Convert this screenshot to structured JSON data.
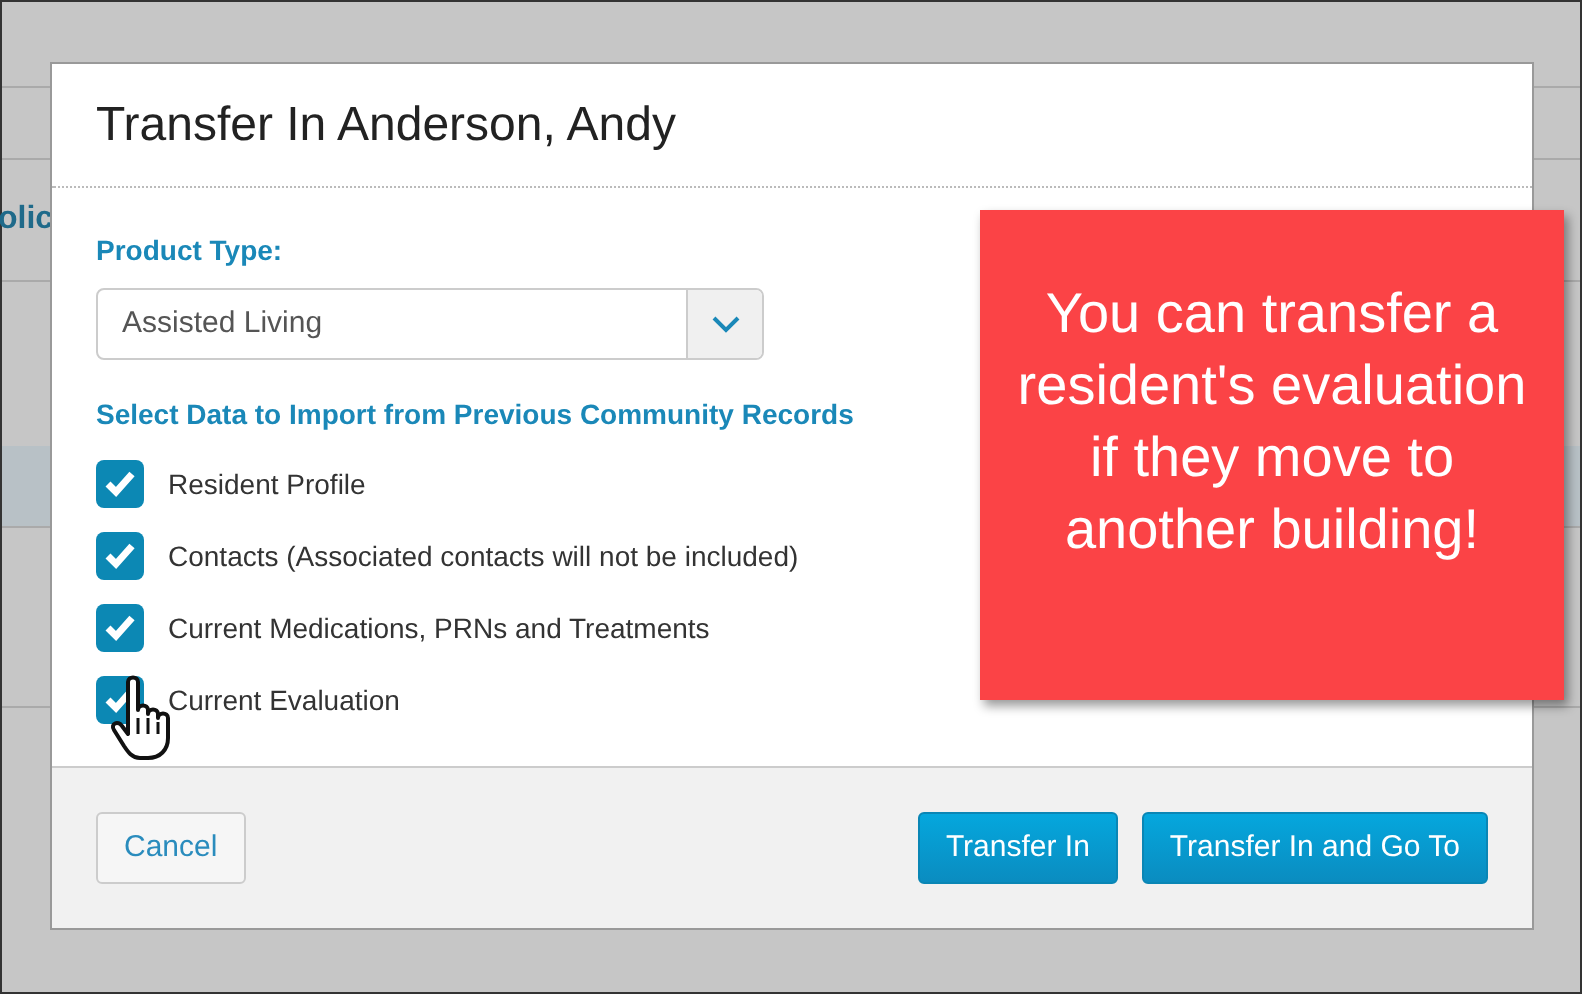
{
  "background": {
    "text_fragment": "olic"
  },
  "dialog": {
    "title": "Transfer In Anderson, Andy",
    "product_type": {
      "label": "Product Type:",
      "value": "Assisted Living"
    },
    "import_heading": "Select Data to Import from Previous Community Records",
    "options": [
      {
        "label": "Resident Profile",
        "checked": true
      },
      {
        "label": "Contacts (Associated contacts will not be included)",
        "checked": true
      },
      {
        "label": "Current Medications, PRNs and Treatments",
        "checked": true
      },
      {
        "label": "Current Evaluation",
        "checked": true
      }
    ],
    "buttons": [
      {
        "label": "Cancel",
        "kind": "secondary"
      },
      {
        "label": "Transfer In",
        "kind": "primary"
      },
      {
        "label": "Transfer In and Go To",
        "kind": "primary"
      }
    ]
  },
  "callout": {
    "text": "You can transfer a resident's evaluation if they move to another building!"
  }
}
